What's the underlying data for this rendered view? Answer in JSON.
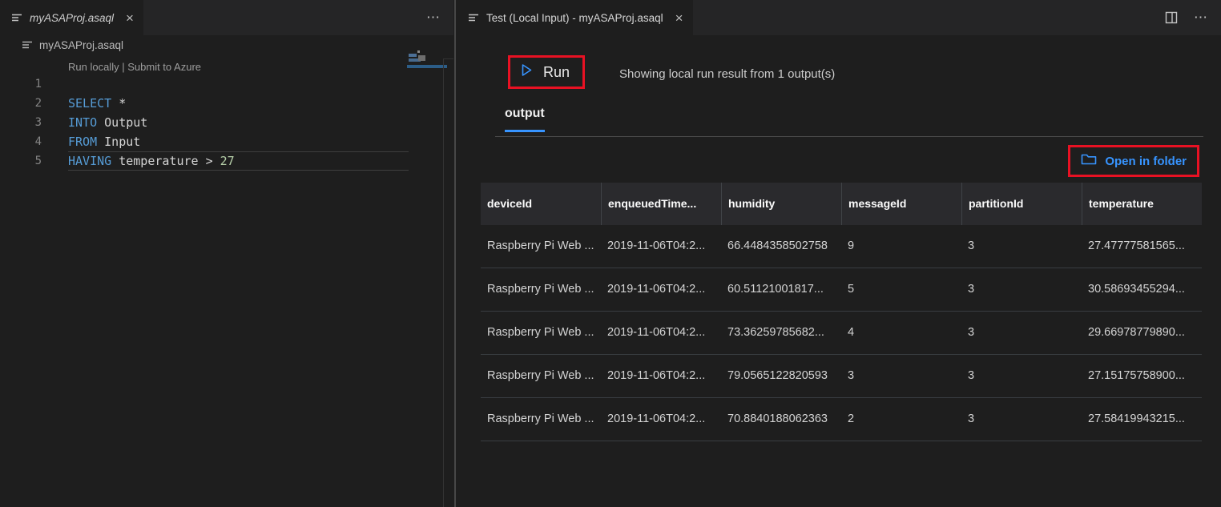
{
  "left_editor": {
    "tab": {
      "title": "myASAProj.asaql"
    },
    "breadcrumb": {
      "file": "myASAProj.asaql"
    },
    "codelens": {
      "run_locally": "Run locally",
      "separator": "|",
      "submit_to_azure": "Submit to Azure"
    },
    "code": {
      "lines": [
        {
          "num": "1",
          "kw": "",
          "rest": "",
          "numlit": ""
        },
        {
          "num": "2",
          "kw": "SELECT",
          "rest": " *",
          "numlit": ""
        },
        {
          "num": "3",
          "kw": "INTO",
          "rest": " Output",
          "numlit": ""
        },
        {
          "num": "4",
          "kw": "FROM",
          "rest": " Input",
          "numlit": ""
        },
        {
          "num": "5",
          "kw": "HAVING",
          "rest": " temperature > ",
          "numlit": "27"
        }
      ]
    }
  },
  "right_panel": {
    "tab": {
      "title": "Test (Local Input) - myASAProj.asaql"
    },
    "run_button": {
      "label": "Run"
    },
    "status_text": "Showing local run result from 1 output(s)",
    "output_tab_label": "output",
    "open_in_folder_label": "Open in folder",
    "table": {
      "columns": [
        "deviceId",
        "enqueuedTime...",
        "humidity",
        "messageId",
        "partitionId",
        "temperature"
      ],
      "rows": [
        [
          "Raspberry Pi Web ...",
          "2019-11-06T04:2...",
          "66.4484358502758",
          "9",
          "3",
          "27.47777581565..."
        ],
        [
          "Raspberry Pi Web ...",
          "2019-11-06T04:2...",
          "60.51121001817...",
          "5",
          "3",
          "30.58693455294..."
        ],
        [
          "Raspberry Pi Web ...",
          "2019-11-06T04:2...",
          "73.36259785682...",
          "4",
          "3",
          "29.66978779890..."
        ],
        [
          "Raspberry Pi Web ...",
          "2019-11-06T04:2...",
          "79.0565122820593",
          "3",
          "3",
          "27.15175758900..."
        ],
        [
          "Raspberry Pi Web ...",
          "2019-11-06T04:2...",
          "70.8840188062363",
          "2",
          "3",
          "27.58419943215..."
        ]
      ]
    }
  },
  "icons": {
    "close": "×",
    "more_actions": "⋯"
  },
  "colors": {
    "annotation_red": "#e81123",
    "accent_blue": "#3794ff",
    "keyword_blue": "#569cd6",
    "number_green": "#b5cea8"
  }
}
